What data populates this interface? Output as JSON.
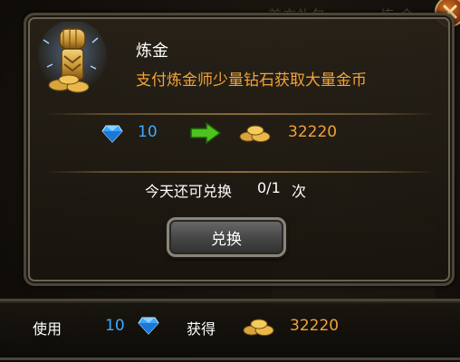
{
  "background": {
    "labels": [
      "首充礼包",
      "炼 金"
    ]
  },
  "dialog": {
    "title": "炼金",
    "description": "支付炼金师少量钻石获取大量金币",
    "exchange": {
      "diamond_cost": "10",
      "gold_gain": "32220"
    },
    "today": {
      "label": "今天还可兑换",
      "count": "0/1",
      "unit": "次"
    },
    "exchange_button": "兑换"
  },
  "bottom_bar": {
    "use_label": "使用",
    "use_amount": "10",
    "gain_label": "获得",
    "gain_amount": "32220"
  },
  "colors": {
    "diamond_blue": "#3fa9ff",
    "gold_orange": "#f0a238",
    "description_orange": "#f2a33a"
  },
  "icons": {
    "fist": "gold-fist-icon",
    "diamond": "diamond-icon",
    "arrow": "green-arrow-icon",
    "coins": "gold-coins-icon",
    "close": "close-icon"
  }
}
